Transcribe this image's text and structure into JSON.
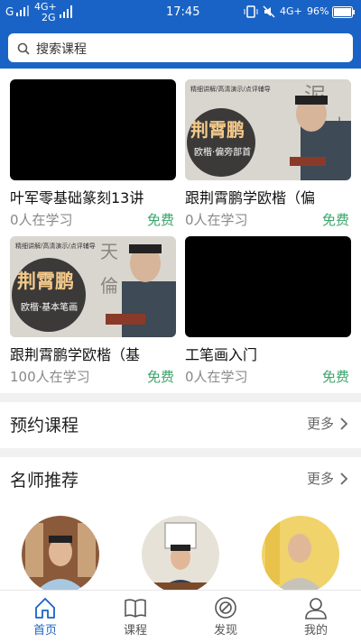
{
  "status_bar": {
    "signal_left": "G",
    "net1": "4G+",
    "net2": "2G",
    "time": "17:45",
    "net3": "4G+",
    "battery": "96%"
  },
  "search": {
    "placeholder": "搜索课程"
  },
  "courses": [
    {
      "title": "叶军零基础篆刻13讲",
      "learners": "0人在学习",
      "price": "免费",
      "thumb": "black"
    },
    {
      "title": "跟荆霄鹏学欧楷（偏",
      "learners": "0人在学习",
      "price": "免费",
      "thumb": "photo",
      "thumb_caption": "精细讲解/高清演示/点评辅导",
      "thumb_name": "荆霄鹏",
      "thumb_sub": "欧楷·偏旁部首"
    },
    {
      "title": "跟荆霄鹏学欧楷（基",
      "learners": "100人在学习",
      "price": "免费",
      "thumb": "photo",
      "thumb_caption": "精细讲解/高清演示/点评辅导",
      "thumb_name": "荆霄鹏",
      "thumb_sub": "欧楷·基本笔画"
    },
    {
      "title": "工笔画入门",
      "learners": "0人在学习",
      "price": "免费",
      "thumb": "black"
    }
  ],
  "reserve_section": {
    "title": "预约课程",
    "more": "更多"
  },
  "teacher_section": {
    "title": "名师推荐",
    "more": "更多"
  },
  "tabs": [
    {
      "label": "首页",
      "icon": "home-icon",
      "active": true
    },
    {
      "label": "课程",
      "icon": "book-icon",
      "active": false
    },
    {
      "label": "发现",
      "icon": "compass-icon",
      "active": false
    },
    {
      "label": "我的",
      "icon": "user-icon",
      "active": false
    }
  ],
  "colors": {
    "primary": "#1a63c6",
    "free_green": "#3aa56a"
  }
}
